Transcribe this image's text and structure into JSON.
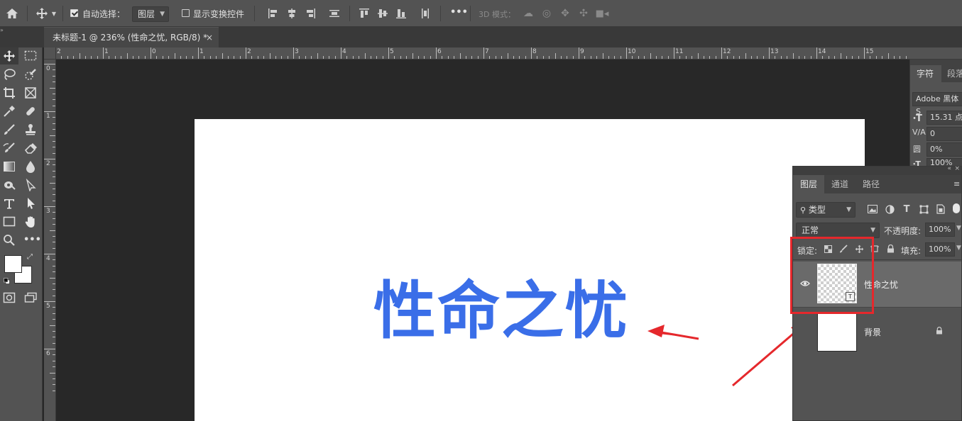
{
  "options_bar": {
    "auto_select_label": "自动选择：",
    "auto_select_checked": true,
    "auto_select_target": "图层",
    "show_transform_label": "显示变换控件",
    "show_transform_checked": false,
    "more_label": "•••",
    "mode_3d_label": "3D 模式："
  },
  "document": {
    "tab_title": "未标题-1 @ 236% (性命之忧, RGB/8) *",
    "close_glyph": "×",
    "canvas_text": "性命之忧",
    "text_color": "#3a6ee8"
  },
  "rulers": {
    "horizontal": [
      "2",
      "1",
      "0",
      "1",
      "2",
      "3",
      "4",
      "5",
      "6",
      "7",
      "8",
      "9",
      "10",
      "11",
      "12",
      "13",
      "14",
      "15"
    ],
    "vertical": [
      "0",
      "1",
      "2",
      "3",
      "4",
      "5",
      "6"
    ]
  },
  "toolbar": {
    "more_label": "•••"
  },
  "character_panel": {
    "tab_active": "字符",
    "tab_other": "段落",
    "font_family": "Adobe 黑体 S",
    "font_size": "15.31 点",
    "kerning": "0",
    "tracking": "0%",
    "vertical_scale": "100%"
  },
  "layers_panel": {
    "tabs": [
      "图层",
      "通道",
      "路径"
    ],
    "filter_kind": "类型",
    "blend_mode": "正常",
    "opacity_label": "不透明度:",
    "opacity_value": "100%",
    "lock_label": "锁定:",
    "fill_label": "填充:",
    "fill_value": "100%",
    "layers": [
      {
        "name": "性命之忧",
        "visible": true,
        "type": "text",
        "selected": true
      },
      {
        "name": "背景",
        "visible": false,
        "type": "background",
        "locked": true
      }
    ]
  },
  "annotation": {
    "highlight_color": "#e5282c"
  }
}
